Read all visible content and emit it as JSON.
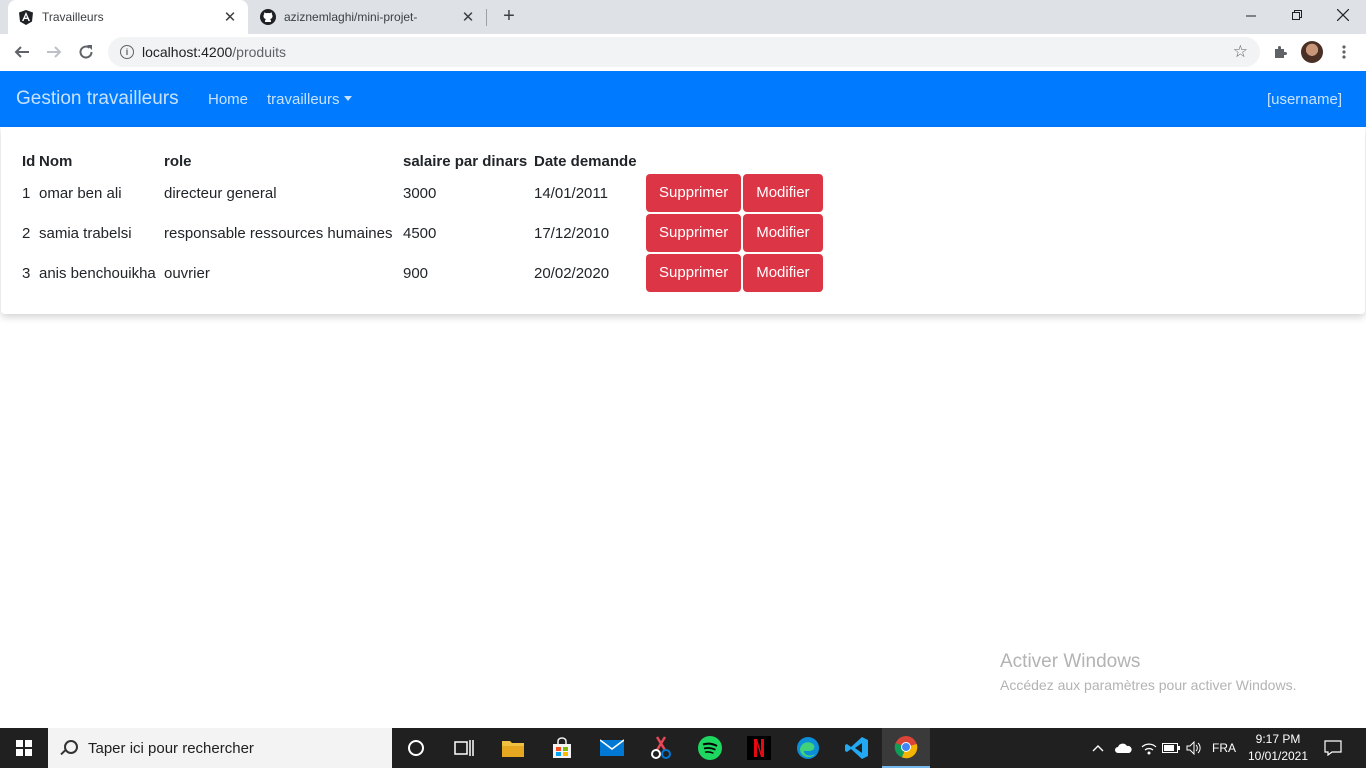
{
  "browser": {
    "tabs": [
      {
        "title": "Travailleurs"
      },
      {
        "title": "aziznemlaghi/mini-projet-"
      }
    ],
    "url_host": "localhost:4200",
    "url_path": "/produits"
  },
  "app": {
    "brand": "Gestion travailleurs",
    "nav": {
      "home": "Home",
      "travailleurs": "travailleurs"
    },
    "user": "[username]"
  },
  "table": {
    "headers": [
      "Id",
      "Nom",
      "role",
      "salaire par dinars",
      "Date demande"
    ],
    "rows": [
      {
        "id": "1",
        "nom": "omar ben ali",
        "role": "directeur general",
        "salaire": "3000",
        "date": "14/01/2011"
      },
      {
        "id": "2",
        "nom": "samia trabelsi",
        "role": "responsable ressources humaines",
        "salaire": "4500",
        "date": "17/12/2010"
      },
      {
        "id": "3",
        "nom": "anis benchouikha",
        "role": "ouvrier",
        "salaire": "900",
        "date": "20/02/2020"
      }
    ],
    "delete_label": "Supprimer",
    "edit_label": "Modifier"
  },
  "watermark": {
    "title": "Activer Windows",
    "subtitle": "Accédez aux paramètres pour activer Windows."
  },
  "taskbar": {
    "search_placeholder": "Taper ici pour rechercher",
    "language": "FRA",
    "time": "9:17 PM",
    "date": "10/01/2021"
  },
  "colors": {
    "navbar": "#007bff",
    "danger": "#dc3545",
    "taskbar": "#202020"
  }
}
